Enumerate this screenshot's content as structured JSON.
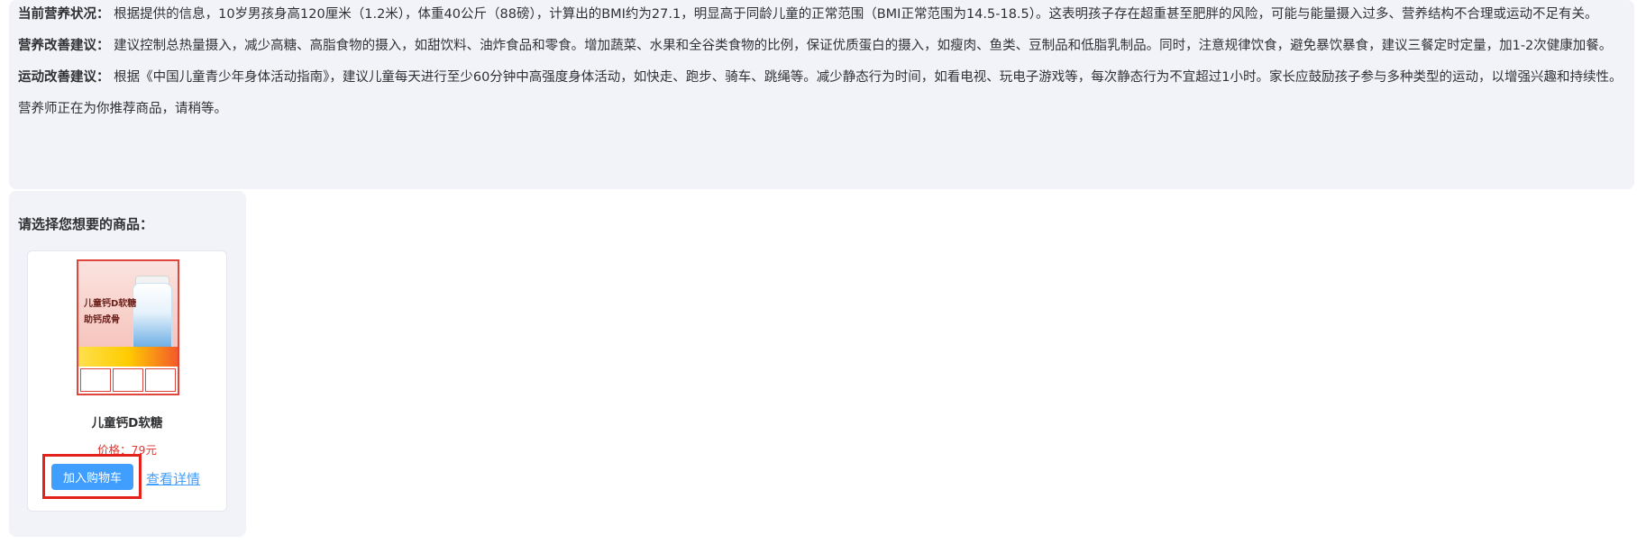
{
  "assistant_message": {
    "nutrition_status": {
      "lead": "当前营养状况：",
      "text": "根据提供的信息，10岁男孩身高120厘米（1.2米），体重40公斤（88磅），计算出的BMI约为27.1，明显高于同龄儿童的正常范围（BMI正常范围为14.5-18.5）。这表明孩子存在超重甚至肥胖的风险，可能与能量摄入过多、营养结构不合理或运动不足有关。"
    },
    "nutrition_advice": {
      "lead": "营养改善建议：",
      "text": "建议控制总热量摄入，减少高糖、高脂食物的摄入，如甜饮料、油炸食品和零食。增加蔬菜、水果和全谷类食物的比例，保证优质蛋白的摄入，如瘦肉、鱼类、豆制品和低脂乳制品。同时，注意规律饮食，避免暴饮暴食，建议三餐定时定量，加1-2次健康加餐。"
    },
    "exercise_advice": {
      "lead": "运动改善建议：",
      "text": "根据《中国儿童青少年身体活动指南》，建议儿童每天进行至少60分钟中高强度身体活动，如快走、跑步、骑车、跳绳等。减少静态行为时间，如看电视、玩电子游戏等，每次静态行为不宜超过1小时。家长应鼓励孩子参与多种类型的运动，以增强兴趣和持续性。"
    },
    "status_note": "营养师正在为你推荐商品，请稍等。"
  },
  "product_panel": {
    "title": "请选择您想要的商品：",
    "products": [
      {
        "name": "儿童钙D软糖",
        "price": "价格：79元",
        "add_to_cart_label": "加入购物车",
        "view_details_label": "查看详情",
        "image": {
          "line1": "儿童钙D软糖",
          "line2": "助钙成骨"
        }
      }
    ]
  },
  "colors": {
    "bubble_bg": "#f1f3f8",
    "primary": "#409eff",
    "price": "#e6372f",
    "highlight": "#e3231b"
  }
}
